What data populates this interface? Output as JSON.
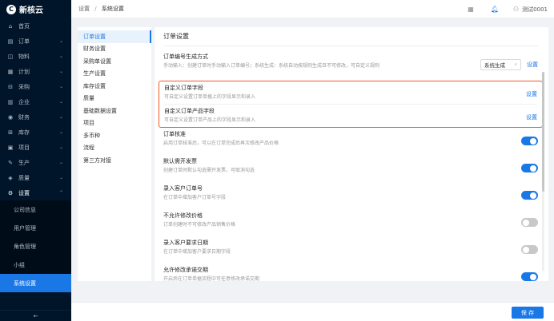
{
  "app": {
    "name": "新核云",
    "logo_glyph": "C"
  },
  "sidebar": {
    "items": [
      {
        "label": "首页",
        "icon": "⌂"
      },
      {
        "label": "订单",
        "icon": "▤"
      },
      {
        "label": "物料",
        "icon": "◫"
      },
      {
        "label": "计划",
        "icon": "▦"
      },
      {
        "label": "采购",
        "icon": "⊟"
      },
      {
        "label": "企业",
        "icon": "▥"
      },
      {
        "label": "财务",
        "icon": "◉"
      },
      {
        "label": "库存",
        "icon": "⊞"
      },
      {
        "label": "项目",
        "icon": "▣"
      },
      {
        "label": "生产",
        "icon": "✎"
      },
      {
        "label": "质量",
        "icon": "◈"
      },
      {
        "label": "设置",
        "icon": "⚙"
      }
    ],
    "submenu": [
      "公司信息",
      "用户管理",
      "角色管理",
      "小组",
      "系统设置"
    ],
    "collapse_icon": "←"
  },
  "header": {
    "breadcrumb": [
      "设置",
      "系统设置"
    ],
    "user": "测试0001"
  },
  "left_nav": [
    "订单设置",
    "财务设置",
    "采购单设置",
    "生产设置",
    "库存设置",
    "质量",
    "基础数据设置",
    "项目",
    "多币种",
    "流程",
    "第三方对接"
  ],
  "main": {
    "section_title": "订单设置",
    "rows": [
      {
        "title": "订单编号生成方式",
        "desc": "手动输入：创建订单时手动输入订单编号；系统生成：系统自动按规则生成且不可修改，可自定义规则",
        "select": "系统生成",
        "link": "设置"
      },
      {
        "title": "自定义订单字段",
        "desc": "可自定义设置订单单据上的字段显示和录入",
        "link": "设置"
      },
      {
        "title": "自定义订单产品字段",
        "desc": "可自定义设置订单产品上的字段显示和录入",
        "link": "设置"
      },
      {
        "title": "订单核准",
        "desc": "启用订单核准后，可以在订单完成后再次修改产品价格",
        "toggle": "on"
      },
      {
        "title": "默认需开发票",
        "desc": "创建订单时默认勾选需开发票，可取消勾选",
        "toggle": "on"
      },
      {
        "title": "录入客户订单号",
        "desc": "在订单中增加客户订单号字段",
        "toggle": "on"
      },
      {
        "title": "不允许修改价格",
        "desc": "订单创建时不可修改产品销售价格",
        "toggle": "off"
      },
      {
        "title": "录入客户要求日期",
        "desc": "在订单中增加客户要求日期字段",
        "toggle": "off"
      },
      {
        "title": "允许修改承诺交期",
        "desc": "开启后在订单单据流程中可任意修改承诺交期",
        "toggle": "on"
      }
    ]
  },
  "footer": {
    "save_label": "保 存"
  },
  "colors": {
    "accent": "#1a78e6",
    "sidebar_bg": "#001529",
    "highlight": "#f05a28"
  }
}
